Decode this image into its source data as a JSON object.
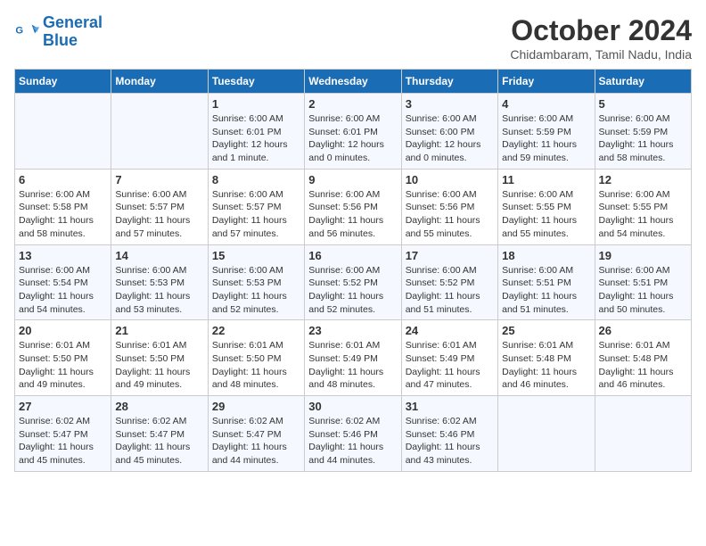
{
  "header": {
    "logo_line1": "General",
    "logo_line2": "Blue",
    "title": "October 2024",
    "location": "Chidambaram, Tamil Nadu, India"
  },
  "days_of_week": [
    "Sunday",
    "Monday",
    "Tuesday",
    "Wednesday",
    "Thursday",
    "Friday",
    "Saturday"
  ],
  "weeks": [
    [
      {
        "day": "",
        "info": ""
      },
      {
        "day": "",
        "info": ""
      },
      {
        "day": "1",
        "info": "Sunrise: 6:00 AM\nSunset: 6:01 PM\nDaylight: 12 hours\nand 1 minute."
      },
      {
        "day": "2",
        "info": "Sunrise: 6:00 AM\nSunset: 6:01 PM\nDaylight: 12 hours\nand 0 minutes."
      },
      {
        "day": "3",
        "info": "Sunrise: 6:00 AM\nSunset: 6:00 PM\nDaylight: 12 hours\nand 0 minutes."
      },
      {
        "day": "4",
        "info": "Sunrise: 6:00 AM\nSunset: 5:59 PM\nDaylight: 11 hours\nand 59 minutes."
      },
      {
        "day": "5",
        "info": "Sunrise: 6:00 AM\nSunset: 5:59 PM\nDaylight: 11 hours\nand 58 minutes."
      }
    ],
    [
      {
        "day": "6",
        "info": "Sunrise: 6:00 AM\nSunset: 5:58 PM\nDaylight: 11 hours\nand 58 minutes."
      },
      {
        "day": "7",
        "info": "Sunrise: 6:00 AM\nSunset: 5:57 PM\nDaylight: 11 hours\nand 57 minutes."
      },
      {
        "day": "8",
        "info": "Sunrise: 6:00 AM\nSunset: 5:57 PM\nDaylight: 11 hours\nand 57 minutes."
      },
      {
        "day": "9",
        "info": "Sunrise: 6:00 AM\nSunset: 5:56 PM\nDaylight: 11 hours\nand 56 minutes."
      },
      {
        "day": "10",
        "info": "Sunrise: 6:00 AM\nSunset: 5:56 PM\nDaylight: 11 hours\nand 55 minutes."
      },
      {
        "day": "11",
        "info": "Sunrise: 6:00 AM\nSunset: 5:55 PM\nDaylight: 11 hours\nand 55 minutes."
      },
      {
        "day": "12",
        "info": "Sunrise: 6:00 AM\nSunset: 5:55 PM\nDaylight: 11 hours\nand 54 minutes."
      }
    ],
    [
      {
        "day": "13",
        "info": "Sunrise: 6:00 AM\nSunset: 5:54 PM\nDaylight: 11 hours\nand 54 minutes."
      },
      {
        "day": "14",
        "info": "Sunrise: 6:00 AM\nSunset: 5:53 PM\nDaylight: 11 hours\nand 53 minutes."
      },
      {
        "day": "15",
        "info": "Sunrise: 6:00 AM\nSunset: 5:53 PM\nDaylight: 11 hours\nand 52 minutes."
      },
      {
        "day": "16",
        "info": "Sunrise: 6:00 AM\nSunset: 5:52 PM\nDaylight: 11 hours\nand 52 minutes."
      },
      {
        "day": "17",
        "info": "Sunrise: 6:00 AM\nSunset: 5:52 PM\nDaylight: 11 hours\nand 51 minutes."
      },
      {
        "day": "18",
        "info": "Sunrise: 6:00 AM\nSunset: 5:51 PM\nDaylight: 11 hours\nand 51 minutes."
      },
      {
        "day": "19",
        "info": "Sunrise: 6:00 AM\nSunset: 5:51 PM\nDaylight: 11 hours\nand 50 minutes."
      }
    ],
    [
      {
        "day": "20",
        "info": "Sunrise: 6:01 AM\nSunset: 5:50 PM\nDaylight: 11 hours\nand 49 minutes."
      },
      {
        "day": "21",
        "info": "Sunrise: 6:01 AM\nSunset: 5:50 PM\nDaylight: 11 hours\nand 49 minutes."
      },
      {
        "day": "22",
        "info": "Sunrise: 6:01 AM\nSunset: 5:50 PM\nDaylight: 11 hours\nand 48 minutes."
      },
      {
        "day": "23",
        "info": "Sunrise: 6:01 AM\nSunset: 5:49 PM\nDaylight: 11 hours\nand 48 minutes."
      },
      {
        "day": "24",
        "info": "Sunrise: 6:01 AM\nSunset: 5:49 PM\nDaylight: 11 hours\nand 47 minutes."
      },
      {
        "day": "25",
        "info": "Sunrise: 6:01 AM\nSunset: 5:48 PM\nDaylight: 11 hours\nand 46 minutes."
      },
      {
        "day": "26",
        "info": "Sunrise: 6:01 AM\nSunset: 5:48 PM\nDaylight: 11 hours\nand 46 minutes."
      }
    ],
    [
      {
        "day": "27",
        "info": "Sunrise: 6:02 AM\nSunset: 5:47 PM\nDaylight: 11 hours\nand 45 minutes."
      },
      {
        "day": "28",
        "info": "Sunrise: 6:02 AM\nSunset: 5:47 PM\nDaylight: 11 hours\nand 45 minutes."
      },
      {
        "day": "29",
        "info": "Sunrise: 6:02 AM\nSunset: 5:47 PM\nDaylight: 11 hours\nand 44 minutes."
      },
      {
        "day": "30",
        "info": "Sunrise: 6:02 AM\nSunset: 5:46 PM\nDaylight: 11 hours\nand 44 minutes."
      },
      {
        "day": "31",
        "info": "Sunrise: 6:02 AM\nSunset: 5:46 PM\nDaylight: 11 hours\nand 43 minutes."
      },
      {
        "day": "",
        "info": ""
      },
      {
        "day": "",
        "info": ""
      }
    ]
  ]
}
